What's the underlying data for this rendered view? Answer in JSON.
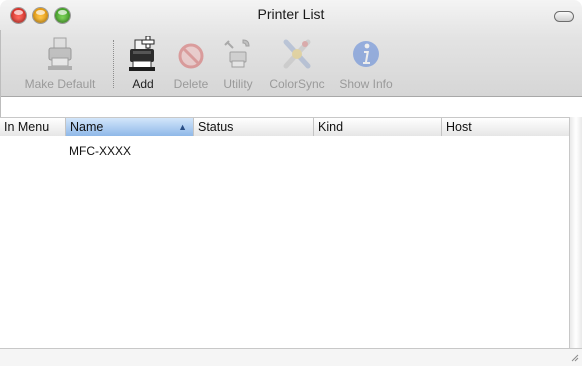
{
  "window": {
    "title": "Printer List"
  },
  "toolbar": {
    "items": [
      {
        "label": "Make Default",
        "icon": "printer-default-icon",
        "enabled": false
      },
      {
        "label": "Add",
        "icon": "add-printer-icon",
        "enabled": true
      },
      {
        "label": "Delete",
        "icon": "delete-icon",
        "enabled": false
      },
      {
        "label": "Utility",
        "icon": "utility-icon",
        "enabled": false
      },
      {
        "label": "ColorSync",
        "icon": "colorsync-icon",
        "enabled": false
      },
      {
        "label": "Show Info",
        "icon": "info-icon",
        "enabled": false
      }
    ]
  },
  "table": {
    "columns": [
      {
        "label": "In Menu"
      },
      {
        "label": "Name",
        "sorted": true
      },
      {
        "label": "Status"
      },
      {
        "label": "Kind"
      },
      {
        "label": "Host"
      }
    ],
    "rows": [
      {
        "in_menu": "",
        "name": "MFC-XXXX",
        "status": "",
        "kind": "",
        "host": ""
      }
    ]
  },
  "colors": {
    "close": "#e0463e",
    "minimize": "#f0a81e",
    "zoom": "#52b533",
    "sorted_header": "#a9c9f0"
  }
}
